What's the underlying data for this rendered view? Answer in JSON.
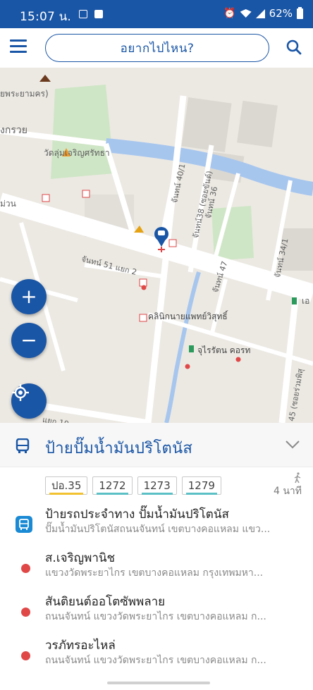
{
  "status_bar": {
    "time": "15:07 น.",
    "battery": "62%"
  },
  "header": {
    "search_placeholder": "อยากไปไหน?"
  },
  "map": {
    "labels": {
      "temple_top": "ยพระยามคร)",
      "road_left": "งกรวย",
      "temple": "วัดลุ่มเจริญศรัทธา",
      "temple_prefix": "วัดลุ่ม",
      "road_bottom_left": "ม่วน",
      "soi_40_1": "จันทน์ 40/1",
      "soi_38": "จันทน์38 (ซอยขันต์)",
      "soi_36": "จันทน์ 36",
      "soi_34_1": "จันทน์ 34/1",
      "soi_51": "จันทน์ 51 แยก 2",
      "soi_47": "จันทน์ 47",
      "clinic": "คลินิกนายแพทย์วิสุทธิ์",
      "condo": "จุไรรัตน คอรท",
      "soi_45": "45 (ซอยร่วมพิสุ",
      "road_lower": "แยก 10",
      "edge_right": "เอ"
    },
    "controls": {
      "zoom_in": "+",
      "zoom_out": "−"
    },
    "colors": {
      "water": "#a7c6ee",
      "park": "#cfe6c6",
      "road": "#ffffff",
      "building": "#dbd8d2",
      "accent": "#1a56a6"
    }
  },
  "stop": {
    "name": "ป้ายปั๊มน้ำมันปริโตนัส",
    "routes": [
      {
        "label": "ปอ.35",
        "color": "#f2c230"
      },
      {
        "label": "1272",
        "color": "#5bc0c6"
      },
      {
        "label": "1273",
        "color": "#5bc0c6"
      },
      {
        "label": "1279",
        "color": "#5bc0c6"
      }
    ],
    "walk_time": "4 นาที"
  },
  "places": [
    {
      "type": "bus-stop",
      "title": "ป้ายรถประจำทาง ปั๊มน้ำมันปริโตนัส",
      "subtitle": "ปั๊มน้ำมันปริโตนัสถนนจันทน์ เขตบางคอแหลม แขว..."
    },
    {
      "type": "place",
      "title": "ส.เจริญพานิช",
      "subtitle": "แขวงวัดพระยาไกร เขตบางคอแหลม กรุงเทพมหา..."
    },
    {
      "type": "place",
      "title": "สันติยนต์ออโตซัพพลาย",
      "subtitle": "ถนนจันทน์ แขวงวัดพระยาไกร เขตบางคอแหลม ก..."
    },
    {
      "type": "place",
      "title": "วรภัทรอะไหล่",
      "subtitle": "ถนนจันทน์ แขวงวัดพระยาไกร เขตบางคอแหลม ก..."
    }
  ]
}
